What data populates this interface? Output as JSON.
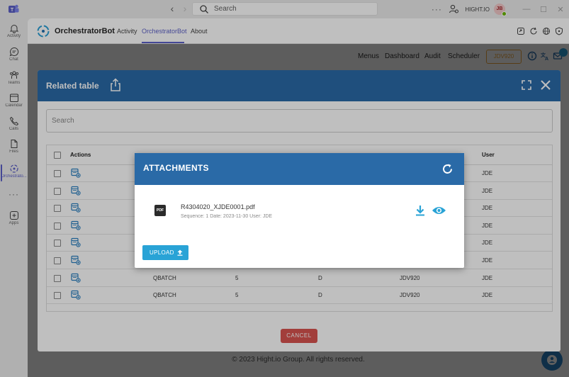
{
  "titlebar": {
    "search_placeholder": "Search",
    "more": "···",
    "org": "HIGHT.IO",
    "avatar_initials": "JB"
  },
  "rail": {
    "items": [
      {
        "label": "Activity",
        "icon": "bell-icon"
      },
      {
        "label": "Chat",
        "icon": "chat-icon"
      },
      {
        "label": "Teams",
        "icon": "teams-icon"
      },
      {
        "label": "Calendar",
        "icon": "calendar-icon"
      },
      {
        "label": "Calls",
        "icon": "phone-icon"
      },
      {
        "label": "Files",
        "icon": "file-icon"
      },
      {
        "label": "Orchestrato...",
        "icon": "orchestrator-icon"
      }
    ],
    "more": "···",
    "apps_label": "Apps"
  },
  "app": {
    "name": "OrchestratorBot",
    "tabs": [
      {
        "label": "Activity",
        "active": false
      },
      {
        "label": "OrchestratorBot",
        "active": true
      },
      {
        "label": "About",
        "active": false
      }
    ],
    "accent": "#5b5fc7"
  },
  "topnav": {
    "items": [
      "Menus",
      "Dashboard",
      "Audit",
      "Scheduler"
    ],
    "env": "JDV920"
  },
  "footer": "© 2023 Hight.io Group. All rights reserved.",
  "related_table": {
    "title": "Related table",
    "search_placeholder": "Search",
    "columns": [
      "Actions",
      "User"
    ],
    "rows": [
      {
        "c1": "",
        "c2": "",
        "c3": "",
        "c4": "",
        "user": "JDE"
      },
      {
        "c1": "",
        "c2": "",
        "c3": "",
        "c4": "",
        "user": "JDE"
      },
      {
        "c1": "",
        "c2": "",
        "c3": "",
        "c4": "",
        "user": "JDE"
      },
      {
        "c1": "",
        "c2": "",
        "c3": "",
        "c4": "",
        "user": "JDE"
      },
      {
        "c1": "",
        "c2": "",
        "c3": "",
        "c4": "",
        "user": "JDE"
      },
      {
        "c1": "",
        "c2": "",
        "c3": "",
        "c4": "",
        "user": "JDE"
      },
      {
        "c1": "QBATCH",
        "c2": "5",
        "c3": "D",
        "c4": "JDV920",
        "user": "JDE"
      },
      {
        "c1": "QBATCH",
        "c2": "5",
        "c3": "D",
        "c4": "JDV920",
        "user": "JDE"
      }
    ],
    "cancel_label": "CANCEL",
    "header_color": "#2a6aa7"
  },
  "attachments": {
    "title": "ATTACHMENTS",
    "file_name": "R4304020_XJDE0001.pdf",
    "file_type": "PDF",
    "meta": "Sequence: 1  Date: 2023-11-30  User: JDE",
    "upload_label": "UPLOAD",
    "accent": "#29a3d6"
  }
}
